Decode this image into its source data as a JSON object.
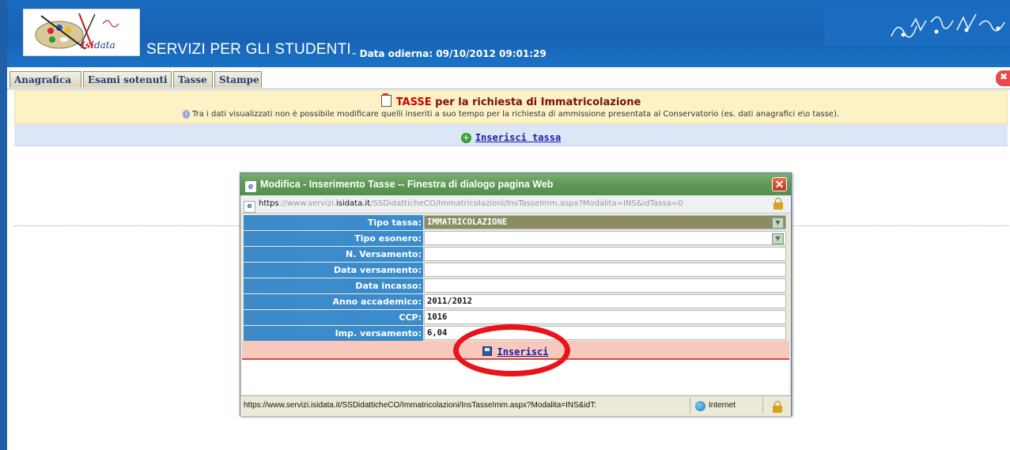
{
  "header": {
    "logo_text_a": "Isi",
    "logo_text_b": "data",
    "site_title": "SERVIZI PER GLI STUDENTI",
    "date_separator": "-",
    "date_label": "Data odierna: 09/10/2012 09:01:29"
  },
  "tabs": [
    {
      "label": "Anagrafica"
    },
    {
      "label": "Esami sotenuti"
    },
    {
      "label": "Tasse"
    },
    {
      "label": "Stampe"
    }
  ],
  "notice": {
    "title_word1": "TASSE",
    "title_word2": "per la richiesta di Immatricolazione",
    "info": "Tra i dati visualizzati non è possibile modificare quelli inseriti a suo tempo per la richiesta di ammissione presentata al Conservatorio (es. dati anagrafici e\\o tasse)."
  },
  "toolbar": {
    "add_label": "Inserisci tassa"
  },
  "dialog": {
    "title": "Modifica - Inserimento Tasse -- Finestra di dialogo pagina Web",
    "url_prefix": "https",
    "url_mid": "://www.servizi.",
    "url_host": "isidata.it",
    "url_path": "/SSDidatticheCO/Immatricolazioni/InsTasseImm.aspx?Modalita=INS&idTassa=0",
    "fields": [
      {
        "label": "Tipo tassa:",
        "value": "IMMATRICOLAZIONE"
      },
      {
        "label": "Tipo esonero:",
        "value": ""
      },
      {
        "label": "N. Versamento:",
        "value": ""
      },
      {
        "label": "Data versamento:",
        "value": ""
      },
      {
        "label": "Data incasso:",
        "value": ""
      },
      {
        "label": "Anno accademico:",
        "value": "2011/2012"
      },
      {
        "label": "CCP:",
        "value": "1016"
      },
      {
        "label": "Imp. versamento:",
        "value": "6,04"
      }
    ],
    "save_label": "Inserisci",
    "status_url": "https://www.servizi.isidata.it/SSDidatticheCO/Immatricolazioni/InsTasseImm.aspx?Modalita=INS&idT:",
    "status_zone": "Internet"
  },
  "colors": {
    "header_blue": "#1762b3",
    "label_blue": "#3a8ccc",
    "dialog_green": "#5d9a55",
    "highlight_red": "#e8131b",
    "notice_yellow": "#fdf2c6"
  }
}
